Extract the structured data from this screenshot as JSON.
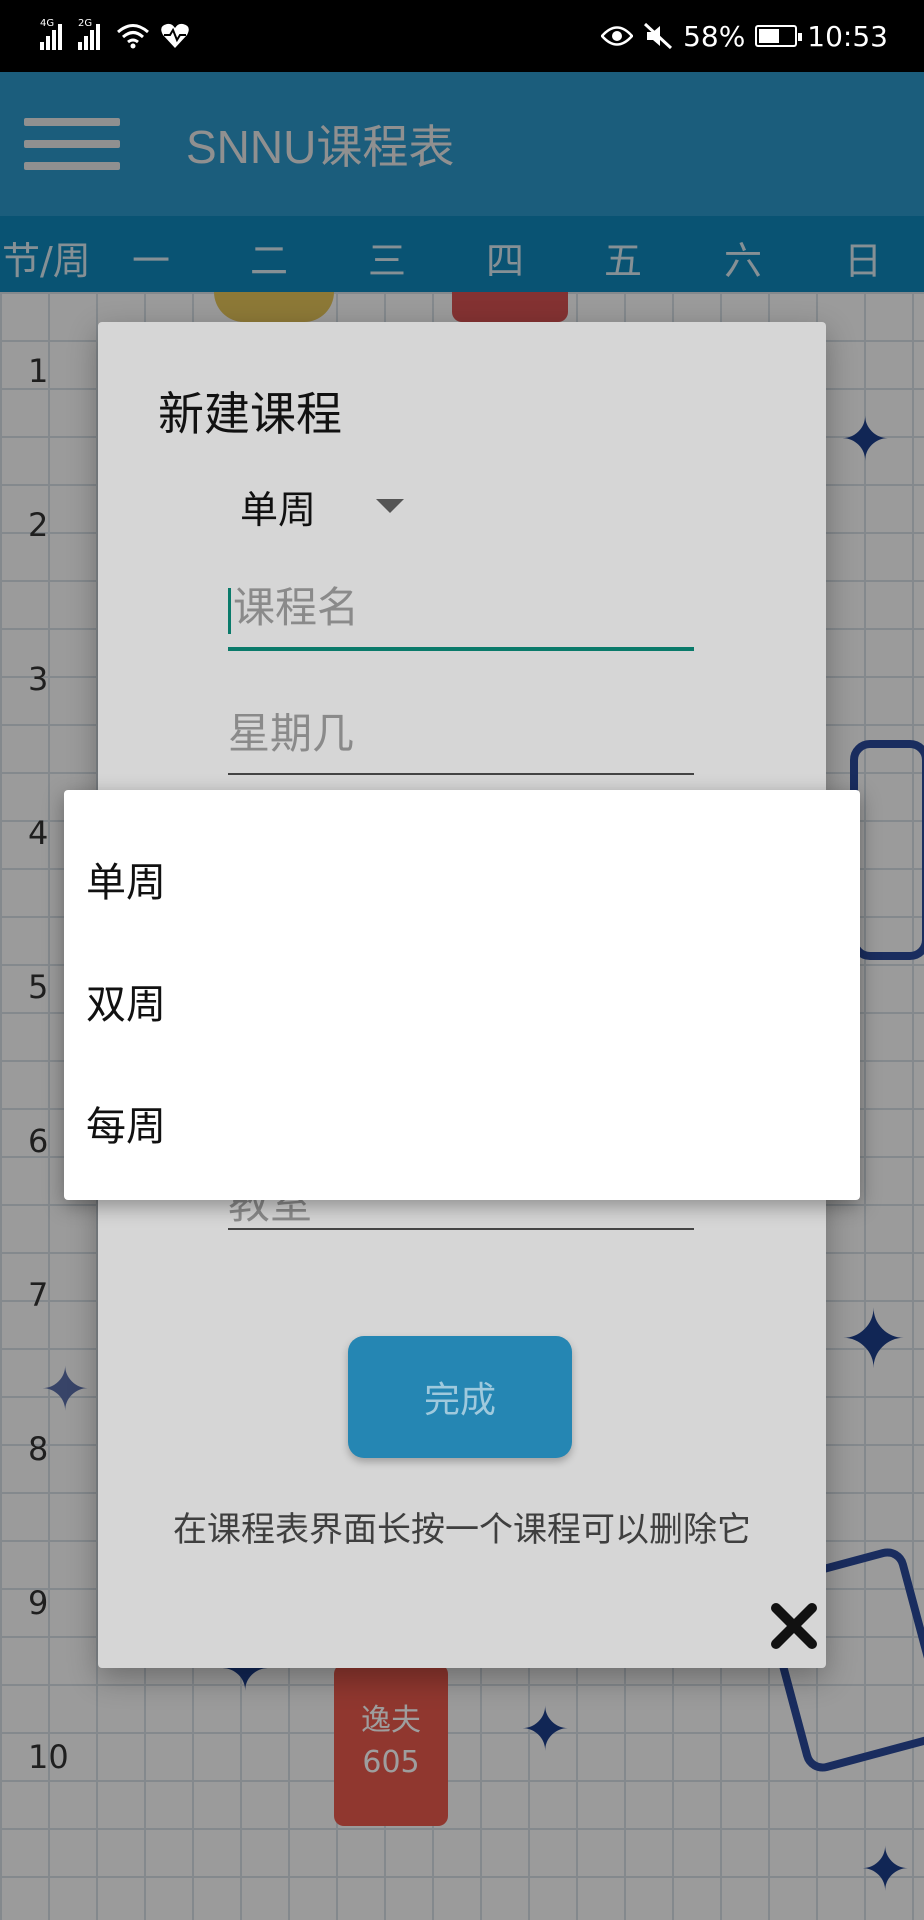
{
  "status_bar": {
    "signal1_label": "4G",
    "signal2_label": "2G",
    "battery_pct": "58%",
    "battery_level": 0.58,
    "time": "10:53",
    "icons": [
      "signal-icon",
      "signal-icon",
      "wifi-icon",
      "heart-rate-icon",
      "eye-icon",
      "mute-icon",
      "battery-icon"
    ]
  },
  "app_bar": {
    "title": "SNNU课程表",
    "menu_icon": "hamburger-menu-icon",
    "color": "#2c97c9"
  },
  "week_header": {
    "corner": "节/周",
    "days": [
      "一",
      "二",
      "三",
      "四",
      "五",
      "六",
      "日"
    ],
    "color": "#0f86ba"
  },
  "periods": [
    "1",
    "2",
    "3",
    "4",
    "5",
    "6",
    "7",
    "8",
    "9",
    "10"
  ],
  "course_block": {
    "line1": "逸夫",
    "line2": "605",
    "color": "#e9594d"
  },
  "dialog": {
    "title": "新建课程",
    "week_type_selected": "单周",
    "course_name_placeholder": "课程名",
    "weekday_placeholder": "星期几",
    "classroom_placeholder": "教室",
    "done_label": "完成",
    "hint": "在课程表界面长按一个课程可以删除它",
    "accent": "#2586b3"
  },
  "dropdown": {
    "options": [
      "单周",
      "双周",
      "每周"
    ]
  }
}
